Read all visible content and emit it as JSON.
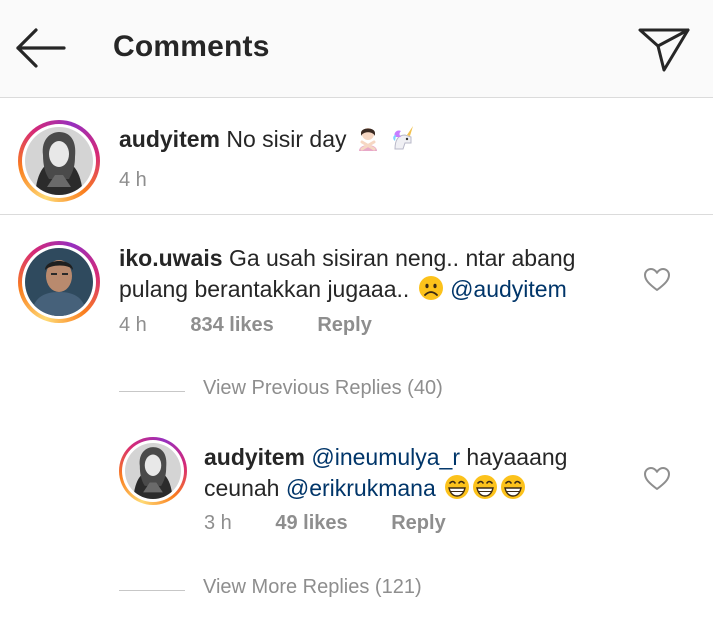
{
  "header": {
    "title": "Comments",
    "back_icon": "arrow-left-icon",
    "send_icon": "paper-plane-icon"
  },
  "caption": {
    "username": "audyitem",
    "text": "No sisir day",
    "time": "4 h"
  },
  "comment": {
    "username": "iko.uwais",
    "line1": "Ga usah sisiran neng.. ntar abang",
    "line2": "pulang berantakkan jugaaa..",
    "mention": "@audyitem",
    "time": "4 h",
    "likes": "834 likes",
    "reply_label": "Reply"
  },
  "view_previous": "View Previous Replies (40)",
  "reply": {
    "username": "audyitem",
    "mention1": "@ineumulya_r",
    "text1": "hayaaang",
    "text2": "ceunah",
    "mention2": "@erikrukmana",
    "time": "3 h",
    "likes": "49 likes",
    "reply_label": "Reply"
  },
  "view_more": "View More Replies (121)",
  "colors": {
    "mention": "#003569",
    "meta": "#8e8e8e",
    "divider": "#dbdbdb"
  }
}
